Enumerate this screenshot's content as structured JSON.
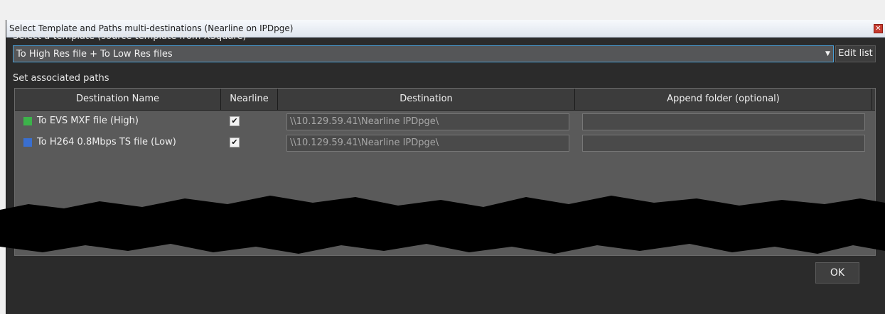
{
  "window": {
    "title": "Select Template and Paths multi-destinations (Nearline on IPDpge)",
    "close_icon": "close-icon"
  },
  "template_section": {
    "label": "Select a template (source template from XSquare)",
    "selected_value": "To High Res file + To Low Res files",
    "edit_list_label": "Edit list"
  },
  "paths_section": {
    "label": "Set associated paths",
    "columns": [
      "Destination Name",
      "Nearline",
      "Destination",
      "Append folder (optional)"
    ],
    "rows": [
      {
        "name": "To EVS MXF file (High)",
        "color": "#3cb34a",
        "nearline": true,
        "nearline_mark": "✔",
        "destination": "\\\\10.129.59.41\\Nearline IPDpge\\",
        "append_folder": ""
      },
      {
        "name": "To H264 0.8Mbps TS file (Low)",
        "color": "#3a6fd0",
        "nearline": true,
        "nearline_mark": "✔",
        "destination": "\\\\10.129.59.41\\Nearline IPDpge\\",
        "append_folder": ""
      }
    ]
  },
  "footer": {
    "ok_label": "OK"
  }
}
